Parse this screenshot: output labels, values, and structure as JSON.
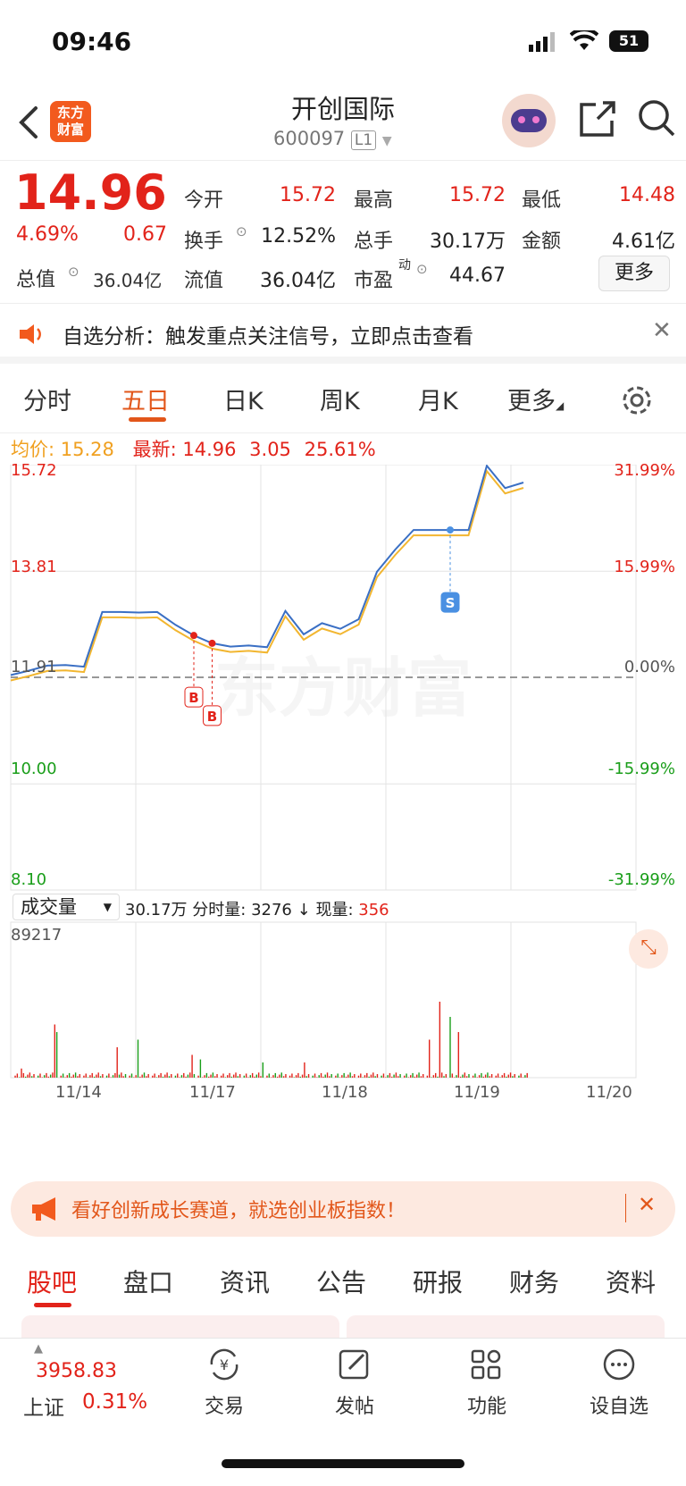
{
  "status": {
    "time": "09:46",
    "battery": "51"
  },
  "header": {
    "title": "开创国际",
    "code": "600097",
    "level": "L1",
    "logo_line1": "东方",
    "logo_line2": "财富"
  },
  "quote": {
    "price": "14.96",
    "change_pct": "4.69%",
    "change": "0.67",
    "open_label": "今开",
    "open": "15.72",
    "high_label": "最高",
    "high": "15.72",
    "low_label": "最低",
    "low": "14.48",
    "turnover_label": "换手",
    "turnover": "12.52%",
    "volume_label": "总手",
    "volume": "30.17万",
    "amount_label": "金额",
    "amount": "4.61亿",
    "mktcap_label": "总值",
    "mktcap": "36.04亿",
    "float_label": "流值",
    "float": "36.04亿",
    "pe_label": "市盈",
    "pe_sup": "动",
    "pe": "44.67",
    "more": "更多"
  },
  "notice": {
    "text": "自选分析：触发重点关注信号，立即点击查看"
  },
  "tabs": [
    "分时",
    "五日",
    "日K",
    "周K",
    "月K",
    "更多"
  ],
  "avgbar": {
    "avg_label": "均价:",
    "avg": "15.28",
    "last_label": "最新:",
    "last": "14.96",
    "chg": "3.05",
    "pct": "25.61%"
  },
  "chart_data": {
    "type": "line",
    "title": "",
    "x_days": [
      "11/14",
      "11/17",
      "11/18",
      "11/19",
      "11/20"
    ],
    "y_left_ticks": [
      "15.72",
      "13.81",
      "11.91",
      "10.00",
      "8.10"
    ],
    "y_right_ticks": [
      "31.99%",
      "15.99%",
      "0.00%",
      "-15.99%",
      "-31.99%"
    ],
    "ylim": [
      8.1,
      15.72
    ],
    "prev_close": 11.91,
    "watermark": "东方财富",
    "series": [
      {
        "name": "",
        "values": [
          11.95,
          12.03,
          12.12,
          12.13,
          12.1,
          13.08,
          13.08,
          13.07,
          13.08,
          12.85,
          12.66,
          12.52,
          12.46,
          12.48,
          12.45,
          13.1,
          12.68,
          12.88,
          12.78,
          12.95,
          13.8,
          14.2,
          14.55,
          14.55,
          14.55,
          14.55,
          15.7,
          15.3,
          15.4
        ]
      }
    ],
    "trades": [
      {
        "label": "B"
      },
      {
        "label": "B"
      },
      {
        "label": "S"
      }
    ],
    "volume": {
      "selector": "成交量",
      "total": "30.17万",
      "tick_label": "分时量:",
      "tick_vol": "3276",
      "now_label": "现量:",
      "now_vol": "356",
      "max": "89217"
    }
  },
  "banner2": {
    "text": "看好创新成长赛道，就选创业板指数！"
  },
  "bottom_tabs": [
    "股吧",
    "盘口",
    "资讯",
    "公告",
    "研报",
    "财务",
    "资料"
  ],
  "toolbar": {
    "index_value": "3958.83",
    "index_name": "上证",
    "index_pct": "0.31%",
    "items": [
      "交易",
      "发帖",
      "功能",
      "设自选"
    ]
  }
}
